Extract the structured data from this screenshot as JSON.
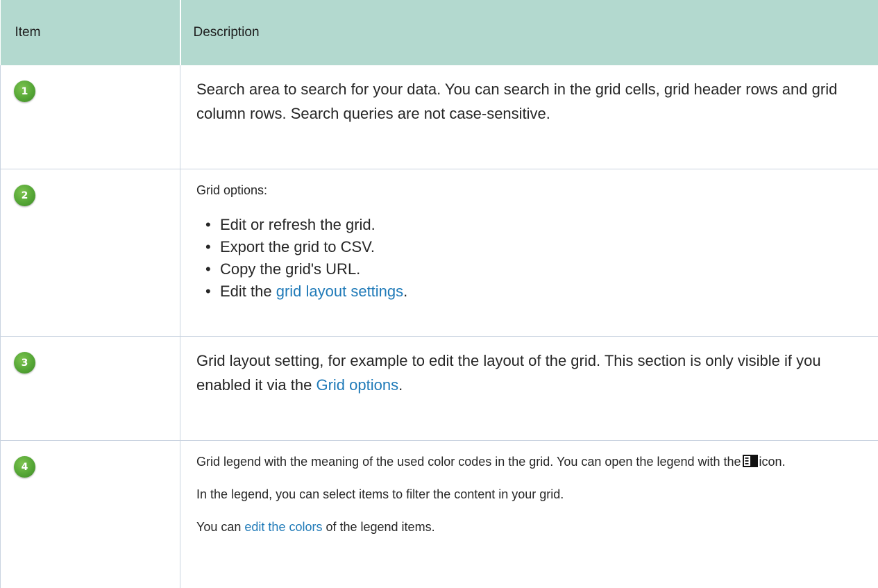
{
  "table": {
    "header_item": "Item",
    "header_description": "Description"
  },
  "rows": [
    {
      "badge": "1",
      "text": "Search area to search for your data. You can search in the grid cells, grid header rows and grid column rows. Search queries are not case-sensitive."
    },
    {
      "badge": "2",
      "intro": "Grid options:",
      "bullets": [
        "Edit or refresh the grid.",
        "Export the grid to CSV.",
        "Copy the grid's URL."
      ],
      "bullet4_prefix": "Edit the ",
      "bullet4_link": "grid layout settings",
      "bullet4_suffix": "."
    },
    {
      "badge": "3",
      "text_prefix": "Grid layout setting, for example to edit the layout of the grid. This section is only visible if you enabled it via the ",
      "link": "Grid options",
      "text_suffix": "."
    },
    {
      "badge": "4",
      "p1_prefix": "Grid legend with the meaning of the used color codes in the grid. You can open the legend with the",
      "p1_icon": "legend-icon",
      "p1_suffix": "icon.",
      "p2": "In the legend, you can select items to filter the content in your grid.",
      "p3_prefix": "You can ",
      "p3_link": "edit the colors",
      "p3_suffix": " of the legend items."
    }
  ],
  "colors": {
    "header_bg": "#b3d9cf",
    "badge_green": "#55a636",
    "link": "#1f7ab8",
    "border": "#c9d3e0"
  }
}
